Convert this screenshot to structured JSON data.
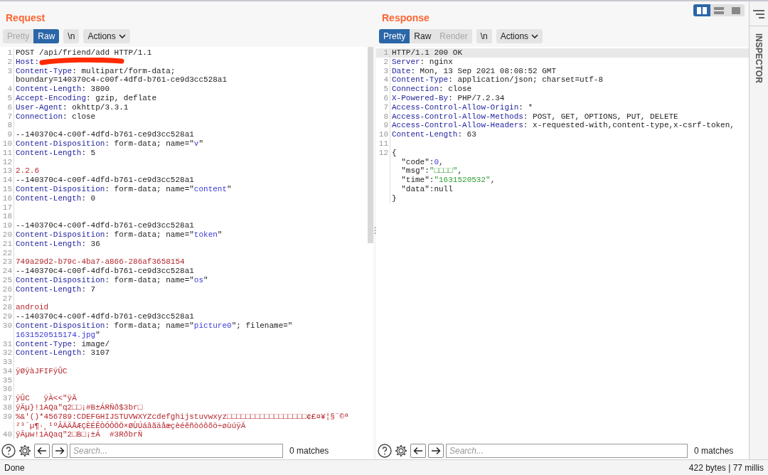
{
  "layout_toggle": [
    {
      "kind": "columns",
      "selected": true
    },
    {
      "kind": "rows",
      "selected": false
    },
    {
      "kind": "single",
      "selected": false
    }
  ],
  "request": {
    "title": "Request",
    "view_tabs": [
      {
        "label": "Pretty",
        "selected": false,
        "disabled": true
      },
      {
        "label": "Raw",
        "selected": true,
        "disabled": false
      }
    ],
    "newline_button": "\\n",
    "actions_button": "Actions",
    "lines": [
      {
        "n": "1",
        "rows": [
          {
            "parts": [
              {
                "text": "POST /api/friend/add HTTP/1.1",
                "kind": "plain"
              }
            ]
          }
        ]
      },
      {
        "n": "2",
        "rows": [
          {
            "parts": [
              {
                "text": "Host:",
                "kind": "key"
              },
              {
                "kind": "redaction"
              }
            ]
          }
        ]
      },
      {
        "n": "3",
        "rows": [
          {
            "parts": [
              {
                "text": "Content-Type",
                "kind": "key"
              },
              {
                "text": ": multipart/form-data;",
                "kind": "plain"
              }
            ]
          },
          {
            "parts": [
              {
                "text": "boundary=140370c4-c00f-4dfd-b761-ce9d3cc528a1",
                "kind": "plain"
              }
            ]
          }
        ]
      },
      {
        "n": "4",
        "rows": [
          {
            "parts": [
              {
                "text": "Content-Length",
                "kind": "key"
              },
              {
                "text": ": 3800",
                "kind": "plain"
              }
            ]
          }
        ]
      },
      {
        "n": "5",
        "rows": [
          {
            "parts": [
              {
                "text": "Accept-Encoding",
                "kind": "key"
              },
              {
                "text": ": gzip, deflate",
                "kind": "plain"
              }
            ]
          }
        ]
      },
      {
        "n": "6",
        "rows": [
          {
            "parts": [
              {
                "text": "User-Agent",
                "kind": "key"
              },
              {
                "text": ": okhttp/3.3.1",
                "kind": "plain"
              }
            ]
          }
        ]
      },
      {
        "n": "7",
        "rows": [
          {
            "parts": [
              {
                "text": "Connection",
                "kind": "key"
              },
              {
                "text": ": close",
                "kind": "plain"
              }
            ]
          }
        ]
      },
      {
        "n": "8"
      },
      {
        "n": "9",
        "rows": [
          {
            "parts": [
              {
                "text": "--140370c4-c00f-4dfd-b761-ce9d3cc528a1",
                "kind": "plain"
              }
            ]
          }
        ]
      },
      {
        "n": "10",
        "rows": [
          {
            "parts": [
              {
                "text": "Content-Disposition",
                "kind": "key"
              },
              {
                "text": ": form-data; name=\"",
                "kind": "plain"
              },
              {
                "text": "v",
                "kind": "string"
              },
              {
                "text": "\"",
                "kind": "plain"
              }
            ]
          }
        ]
      },
      {
        "n": "11",
        "rows": [
          {
            "parts": [
              {
                "text": "Content-Length",
                "kind": "key"
              },
              {
                "text": ": 5",
                "kind": "plain"
              }
            ]
          }
        ]
      },
      {
        "n": "12"
      },
      {
        "n": "13",
        "rows": [
          {
            "parts": [
              {
                "text": "2.2.6",
                "kind": "value"
              }
            ]
          }
        ]
      },
      {
        "n": "14",
        "rows": [
          {
            "parts": [
              {
                "text": "--140370c4-c00f-4dfd-b761-ce9d3cc528a1",
                "kind": "plain"
              }
            ]
          }
        ]
      },
      {
        "n": "15",
        "rows": [
          {
            "parts": [
              {
                "text": "Content-Disposition",
                "kind": "key"
              },
              {
                "text": ": form-data; name=\"",
                "kind": "plain"
              },
              {
                "text": "content",
                "kind": "string"
              },
              {
                "text": "\"",
                "kind": "plain"
              }
            ]
          }
        ]
      },
      {
        "n": "16",
        "rows": [
          {
            "parts": [
              {
                "text": "Content-Length",
                "kind": "key"
              },
              {
                "text": ": 0",
                "kind": "plain"
              }
            ]
          }
        ]
      },
      {
        "n": "17"
      },
      {
        "n": "18"
      },
      {
        "n": "19",
        "rows": [
          {
            "parts": [
              {
                "text": "--140370c4-c00f-4dfd-b761-ce9d3cc528a1",
                "kind": "plain"
              }
            ]
          }
        ]
      },
      {
        "n": "20",
        "rows": [
          {
            "parts": [
              {
                "text": "Content-Disposition",
                "kind": "key"
              },
              {
                "text": ": form-data; name=\"",
                "kind": "plain"
              },
              {
                "text": "token",
                "kind": "string"
              },
              {
                "text": "\"",
                "kind": "plain"
              }
            ]
          }
        ]
      },
      {
        "n": "21",
        "rows": [
          {
            "parts": [
              {
                "text": "Content-Length",
                "kind": "key"
              },
              {
                "text": ": 36",
                "kind": "plain"
              }
            ]
          }
        ]
      },
      {
        "n": "22"
      },
      {
        "n": "23",
        "rows": [
          {
            "parts": [
              {
                "text": "749a29d2-b79c-4ba7-a866-286af3658154",
                "kind": "value"
              }
            ]
          }
        ]
      },
      {
        "n": "24",
        "rows": [
          {
            "parts": [
              {
                "text": "--140370c4-c00f-4dfd-b761-ce9d3cc528a1",
                "kind": "plain"
              }
            ]
          }
        ]
      },
      {
        "n": "25",
        "rows": [
          {
            "parts": [
              {
                "text": "Content-Disposition",
                "kind": "key"
              },
              {
                "text": ": form-data; name=\"",
                "kind": "plain"
              },
              {
                "text": "os",
                "kind": "string"
              },
              {
                "text": "\"",
                "kind": "plain"
              }
            ]
          }
        ]
      },
      {
        "n": "26",
        "rows": [
          {
            "parts": [
              {
                "text": "Content-Length",
                "kind": "key"
              },
              {
                "text": ": 7",
                "kind": "plain"
              }
            ]
          }
        ]
      },
      {
        "n": "27"
      },
      {
        "n": "28",
        "rows": [
          {
            "parts": [
              {
                "text": "android",
                "kind": "value"
              }
            ]
          }
        ]
      },
      {
        "n": "29",
        "rows": [
          {
            "parts": [
              {
                "text": "--140370c4-c00f-4dfd-b761-ce9d3cc528a1",
                "kind": "plain"
              }
            ]
          }
        ]
      },
      {
        "n": "30",
        "rows": [
          {
            "parts": [
              {
                "text": "Content-Disposition",
                "kind": "key"
              },
              {
                "text": ": form-data; name=\"",
                "kind": "plain"
              },
              {
                "text": "picture0",
                "kind": "string"
              },
              {
                "text": "\"; filename=\"",
                "kind": "plain"
              }
            ]
          },
          {
            "parts": [
              {
                "text": "1631520515174.jpg",
                "kind": "string"
              },
              {
                "text": "\"",
                "kind": "plain"
              }
            ]
          }
        ]
      },
      {
        "n": "31",
        "rows": [
          {
            "parts": [
              {
                "text": "Content-Type",
                "kind": "key"
              },
              {
                "text": ": image/",
                "kind": "plain"
              }
            ]
          }
        ]
      },
      {
        "n": "32",
        "rows": [
          {
            "parts": [
              {
                "text": "Content-Length",
                "kind": "key"
              },
              {
                "text": ": 3107",
                "kind": "plain"
              }
            ]
          }
        ]
      },
      {
        "n": "33"
      },
      {
        "n": "34",
        "rows": [
          {
            "parts": [
              {
                "text": "ÿØÿàJFIFÿÛC",
                "kind": "value"
              }
            ]
          }
        ]
      },
      {
        "n": "35"
      },
      {
        "n": "36"
      },
      {
        "n": "37",
        "rows": [
          {
            "parts": [
              {
                "text": "ÿÛC   ÿÀ<<\"ÿÄ",
                "kind": "value"
              }
            ]
          }
        ]
      },
      {
        "n": "38",
        "rows": [
          {
            "parts": [
              {
                "text": "ÿÄµ}!1AQa\"q2□□¡#B±ÁRÑð$3br□",
                "kind": "value"
              }
            ]
          }
        ]
      },
      {
        "n": "39",
        "rows": [
          {
            "parts": [
              {
                "text": "%&'()*456789:CDEFGHIJSTUVWXYZcdefghijstuvwxyz□□□□□□□□□□□□□□□□□¢£¤¥¦§¨©ª",
                "kind": "value"
              }
            ]
          },
          {
            "parts": [
              {
                "text": "²³´µ¶·¸¹ºÂÃÄÅÆÇÈÉÊÒÓÔÕÖ×ØÙÚáâãäåæçèéêñòóôõö÷øùúÿÄ",
                "kind": "value"
              }
            ]
          }
        ]
      },
      {
        "n": "40",
        "rows": [
          {
            "parts": [
              {
                "text": "ÿÄµw!1AQaq\"2□B□¡±Á  #3RðbrÑ",
                "kind": "value"
              }
            ]
          }
        ]
      }
    ],
    "search": {
      "placeholder": "Search...",
      "matches": "0 matches"
    }
  },
  "response": {
    "title": "Response",
    "view_tabs": [
      {
        "label": "Pretty",
        "selected": true,
        "disabled": false
      },
      {
        "label": "Raw",
        "selected": false,
        "disabled": false
      },
      {
        "label": "Render",
        "selected": false,
        "disabled": true
      }
    ],
    "newline_button": "\\n",
    "actions_button": "Actions",
    "lines": [
      {
        "n": "1",
        "highlighted": true,
        "rows": [
          {
            "parts": [
              {
                "text": "HTTP/1.1 200 OK",
                "kind": "plain"
              }
            ]
          }
        ]
      },
      {
        "n": "2",
        "highlighted": false,
        "rows": [
          {
            "parts": [
              {
                "text": "Server",
                "kind": "key"
              },
              {
                "text": ": nginx",
                "kind": "plain"
              }
            ]
          }
        ]
      },
      {
        "n": "3",
        "highlighted": false,
        "rows": [
          {
            "parts": [
              {
                "text": "Date",
                "kind": "key"
              },
              {
                "text": ": Mon, 13 Sep 2021 08:08:52 GMT",
                "kind": "plain"
              }
            ]
          }
        ]
      },
      {
        "n": "4",
        "highlighted": false,
        "rows": [
          {
            "parts": [
              {
                "text": "Content-Type",
                "kind": "key"
              },
              {
                "text": ": application/json; charset=utf-8",
                "kind": "plain"
              }
            ]
          }
        ]
      },
      {
        "n": "5",
        "highlighted": false,
        "rows": [
          {
            "parts": [
              {
                "text": "Connection",
                "kind": "key"
              },
              {
                "text": ": close",
                "kind": "plain"
              }
            ]
          }
        ]
      },
      {
        "n": "6",
        "highlighted": false,
        "rows": [
          {
            "parts": [
              {
                "text": "X-Powered-By",
                "kind": "key"
              },
              {
                "text": ": PHP/7.2.34",
                "kind": "plain"
              }
            ]
          }
        ]
      },
      {
        "n": "7",
        "highlighted": false,
        "rows": [
          {
            "parts": [
              {
                "text": "Access-Control-Allow-Origin",
                "kind": "key"
              },
              {
                "text": ": *",
                "kind": "plain"
              }
            ]
          }
        ]
      },
      {
        "n": "8",
        "highlighted": false,
        "rows": [
          {
            "parts": [
              {
                "text": "Access-Control-Allow-Methods",
                "kind": "key"
              },
              {
                "text": ": POST, GET, OPTIONS, PUT, DELETE",
                "kind": "plain"
              }
            ]
          }
        ]
      },
      {
        "n": "9",
        "highlighted": false,
        "rows": [
          {
            "parts": [
              {
                "text": "Access-Control-Allow-Headers",
                "kind": "key"
              },
              {
                "text": ": x-requested-with,content-type,x-csrf-token,",
                "kind": "plain"
              }
            ]
          }
        ]
      },
      {
        "n": "10",
        "highlighted": false,
        "rows": [
          {
            "parts": [
              {
                "text": "Content-Length",
                "kind": "key"
              },
              {
                "text": ": 63",
                "kind": "plain"
              }
            ]
          }
        ]
      },
      {
        "n": "11",
        "highlighted": false
      },
      {
        "n": "12",
        "highlighted": false,
        "rows": [
          {
            "parts": [
              {
                "text": "{",
                "kind": "plain"
              }
            ]
          },
          {
            "parts": [
              {
                "text": "  \"code\":",
                "kind": "plain"
              },
              {
                "text": "0",
                "kind": "number"
              },
              {
                "text": ",",
                "kind": "plain"
              }
            ]
          },
          {
            "parts": [
              {
                "text": "  \"msg\":",
                "kind": "plain"
              },
              {
                "text": "\"□□□□\"",
                "kind": "green"
              },
              {
                "text": ",",
                "kind": "plain"
              }
            ]
          },
          {
            "parts": [
              {
                "text": "  \"time\":",
                "kind": "plain"
              },
              {
                "text": "\"1631520532\"",
                "kind": "green"
              },
              {
                "text": ",",
                "kind": "plain"
              }
            ]
          },
          {
            "parts": [
              {
                "text": "  \"data\":null",
                "kind": "plain"
              }
            ]
          },
          {
            "parts": [
              {
                "text": "}",
                "kind": "plain"
              }
            ]
          }
        ]
      }
    ],
    "search": {
      "placeholder": "Search...",
      "matches": "0 matches"
    }
  },
  "inspector": {
    "label": "INSPECTOR"
  },
  "status_bar": {
    "left": "Done",
    "right": "422 bytes | 77 millis"
  }
}
